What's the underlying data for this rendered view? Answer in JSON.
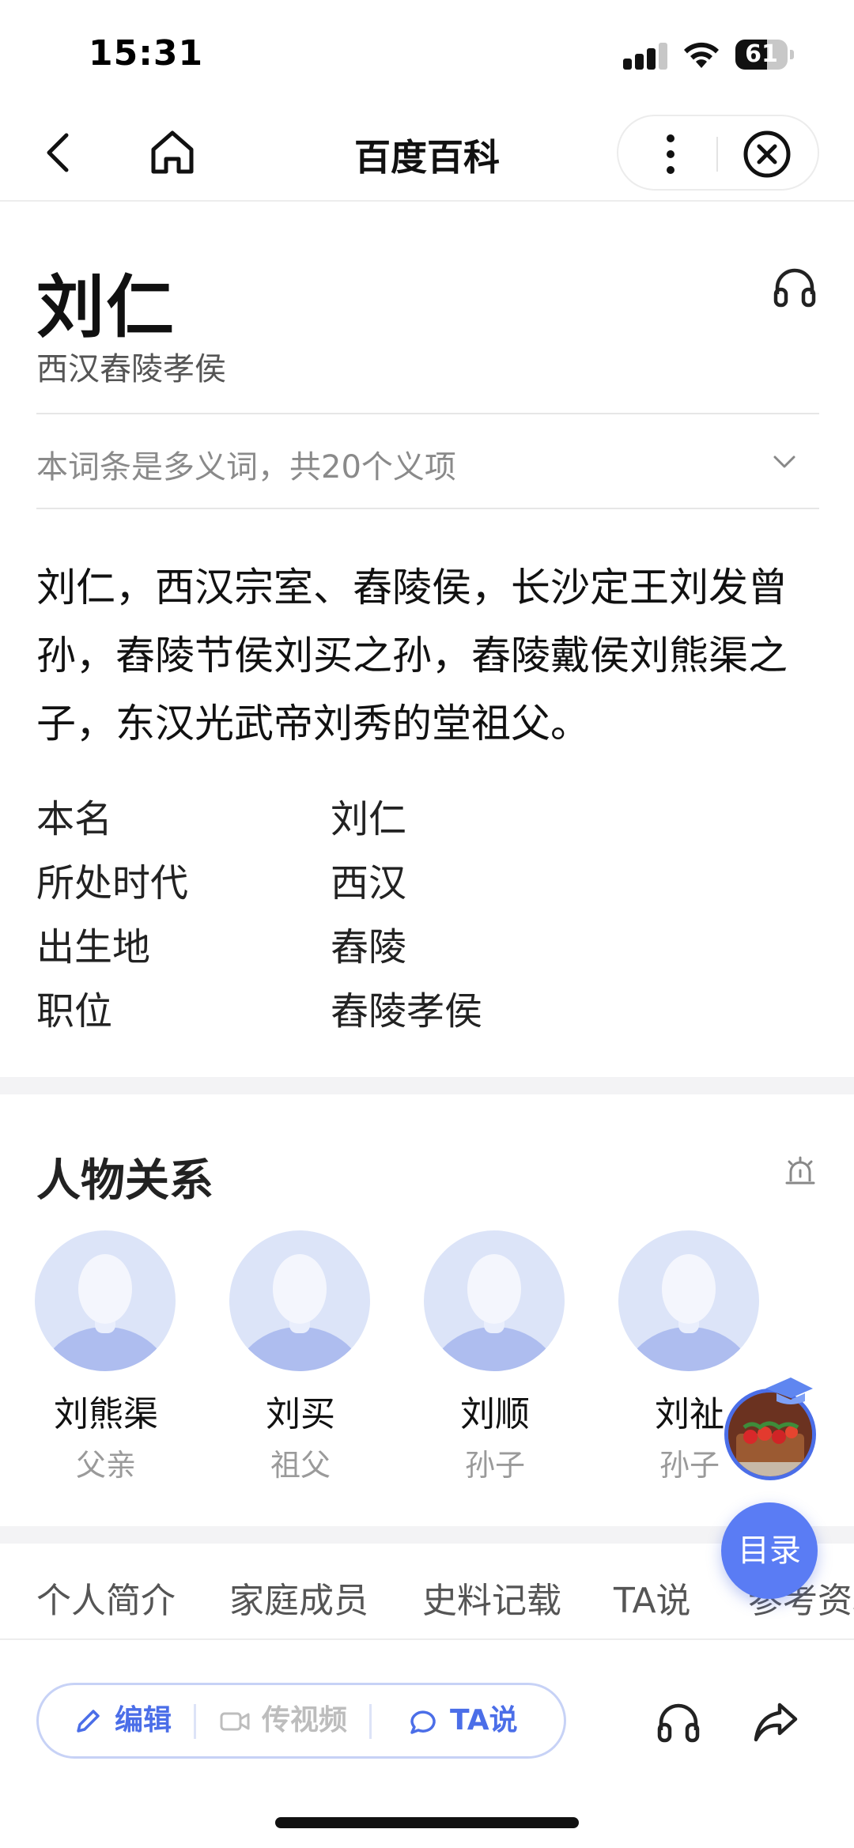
{
  "status_bar": {
    "time": "15:31",
    "battery_level": "61",
    "battery_fraction": 0.61
  },
  "nav": {
    "title": "百度百科",
    "icons": [
      "back-icon",
      "home-icon",
      "more-icon",
      "close-icon"
    ]
  },
  "entry": {
    "title": "刘仁",
    "subtitle": "西汉舂陵孝侯",
    "polysemy_note": "本词条是多义词，共20个义项",
    "summary": "刘仁，西汉宗室、舂陵侯，长沙定王刘发曾孙，舂陵节侯刘买之孙，舂陵戴侯刘熊渠之子，东汉光武帝刘秀的堂祖父。"
  },
  "infobox": [
    {
      "key": "本名",
      "value": "刘仁"
    },
    {
      "key": "所处时代",
      "value": "西汉"
    },
    {
      "key": "出生地",
      "value": "舂陵"
    },
    {
      "key": "职位",
      "value": "舂陵孝侯"
    }
  ],
  "relations": {
    "title": "人物关系",
    "people": [
      {
        "name": "刘熊渠",
        "role": "父亲"
      },
      {
        "name": "刘买",
        "role": "祖父"
      },
      {
        "name": "刘顺",
        "role": "孙子"
      },
      {
        "name": "刘祉",
        "role": "孙子"
      }
    ]
  },
  "toc_button": "目录",
  "tabs": [
    "个人简介",
    "家庭成员",
    "史料记载",
    "TA说",
    "参考资料"
  ],
  "toolbar": {
    "edit": "编辑",
    "video": "传视频",
    "ta_say": "TA说"
  },
  "colors": {
    "accent": "#4b6ee8",
    "toc_button": "#5a7cf4",
    "muted_text": "#8a8a8a",
    "avatar_bg": "#dce4f8"
  }
}
